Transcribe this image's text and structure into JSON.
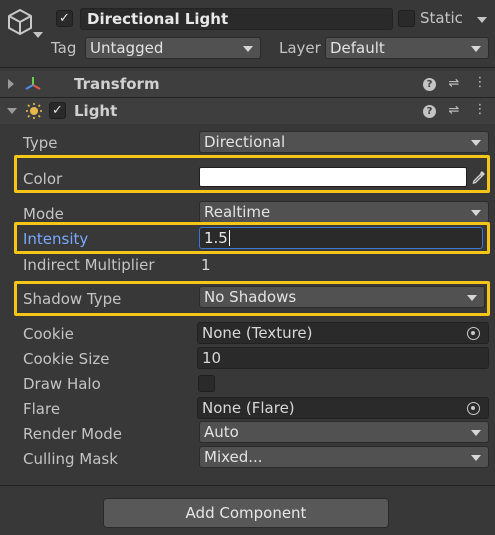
{
  "header": {
    "object_icon": "cube-icon",
    "active_checked": true,
    "object_name": "Directional Light",
    "static_checked": false,
    "static_label": "Static",
    "tag_label": "Tag",
    "tag_value": "Untagged",
    "layer_label": "Layer",
    "layer_value": "Default"
  },
  "components": {
    "transform": {
      "title": "Transform",
      "icon": "transform-axes-icon",
      "expanded": false
    },
    "light": {
      "title": "Light",
      "icon": "light-icon",
      "expanded": true,
      "enabled": true
    }
  },
  "light_props": {
    "type": {
      "label": "Type",
      "value": "Directional"
    },
    "color": {
      "label": "Color",
      "value": "#ffffff",
      "picker_icon": "eyedropper-icon"
    },
    "mode": {
      "label": "Mode",
      "value": "Realtime"
    },
    "intensity": {
      "label": "Intensity",
      "value": "1.5"
    },
    "indirect_multiplier": {
      "label": "Indirect Multiplier",
      "value": "1"
    },
    "shadow_type": {
      "label": "Shadow Type",
      "value": "No Shadows"
    },
    "cookie": {
      "label": "Cookie",
      "value": "None (Texture)"
    },
    "cookie_size": {
      "label": "Cookie Size",
      "value": "10"
    },
    "draw_halo": {
      "label": "Draw Halo",
      "checked": false
    },
    "flare": {
      "label": "Flare",
      "value": "None (Flare)"
    },
    "render_mode": {
      "label": "Render Mode",
      "value": "Auto"
    },
    "culling_mask": {
      "label": "Culling Mask",
      "value": "Mixed..."
    }
  },
  "footer": {
    "add_component_label": "Add Component"
  },
  "highlight_color": "#f5c518",
  "focus_label_color": "#7aa8ff"
}
